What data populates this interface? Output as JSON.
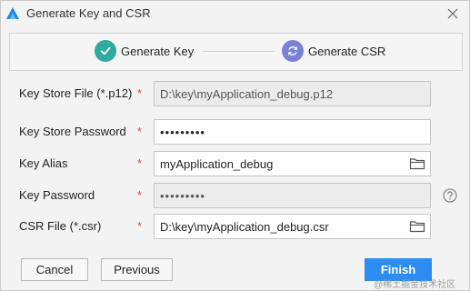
{
  "window": {
    "title": "Generate Key and CSR"
  },
  "steps": [
    {
      "label": "Generate Key",
      "state": "completed",
      "icon": "check-icon"
    },
    {
      "label": "Generate CSR",
      "state": "active",
      "icon": "refresh-icon"
    }
  ],
  "form": {
    "key_store_file": {
      "label": "Key Store File (*.p12)",
      "required": "*",
      "value": "D:\\key\\myApplication_debug.p12"
    },
    "key_store_password": {
      "label": "Key Store Password",
      "required": "*",
      "value": "•••••••••"
    },
    "key_alias": {
      "label": "Key Alias",
      "required": "*",
      "value": "myApplication_debug"
    },
    "key_password": {
      "label": "Key Password",
      "required": "*",
      "value": "•••••••••"
    },
    "csr_file": {
      "label": "CSR File (*.csr)",
      "required": "*",
      "value": "D:\\key\\myApplication_debug.csr"
    }
  },
  "buttons": {
    "cancel": "Cancel",
    "previous": "Previous",
    "finish": "Finish"
  },
  "watermark": "@稀土掘金技术社区",
  "colors": {
    "accent": "#2d8cf0",
    "step_done": "#30a99e",
    "step_active": "#7a82d6",
    "required": "#e04747"
  }
}
